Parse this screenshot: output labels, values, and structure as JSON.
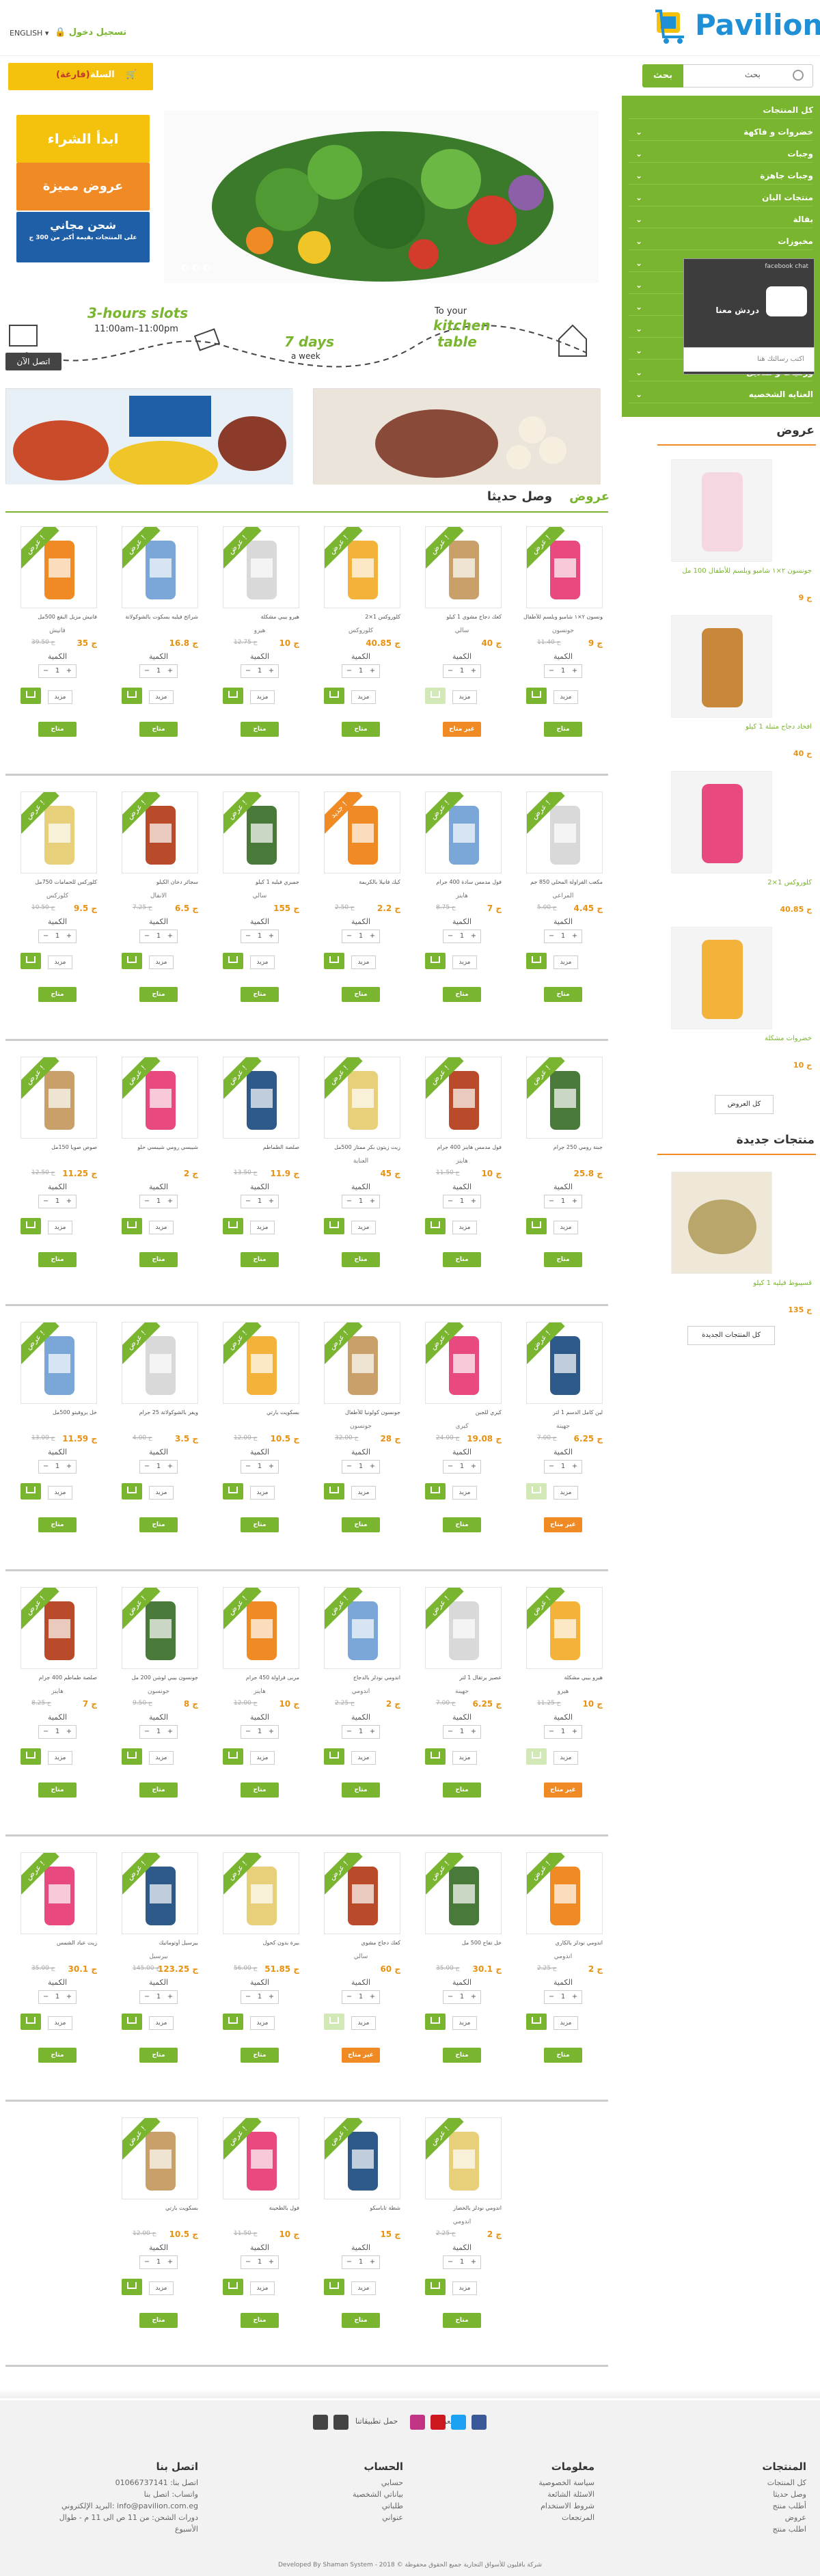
{
  "header": {
    "brand": "Pavilion",
    "language": "ENGLISH",
    "login": "تسجيل دخول",
    "cart_label": "السلة",
    "cart_status": "(فارغة)",
    "search_button": "بحث",
    "search_label": "بحث"
  },
  "sidebar": {
    "items": [
      "كل المنتجات",
      "خضروات و فاكهة",
      "وجبات",
      "وجبات جاهزة",
      "منتجات البان",
      "بقالة",
      "مخبوزات",
      "مجمدات",
      "لحوم",
      "منظفات",
      "مشروبات",
      "كنديرين",
      "ورقيات و مناديل",
      "العنايه الشخصيه"
    ]
  },
  "chat": {
    "title": "facebook chat",
    "cta": "دردش معنا",
    "input_placeholder": "اكتب رسالتك هنا"
  },
  "promos": {
    "start": "ابدأ الشراء",
    "offers": "عروض مميزة",
    "shipping_title": "شحن مجاني",
    "shipping_sub": "على المنتجات بقيمة أكبر من 300 ج"
  },
  "delivery": {
    "slots": "3-hours slots",
    "hours": "11:00am–11:00pm",
    "days": "7 days",
    "week": "a week",
    "to": "To your",
    "kitchen": "kitchen",
    "table": "table",
    "call": "اتصل الآن"
  },
  "section": {
    "tab_offers": "عروض",
    "tab_new": "وصل حديثا"
  },
  "card": {
    "qty_label": "الكمية",
    "qty_value": "1",
    "more": "مزيد",
    "available": "متاح",
    "unavailable": "غير متاح",
    "offer_ribbon": "عرض !",
    "new_ribbon": "جديد !"
  },
  "products": [
    [
      {
        "name": "جونسون ٢×١ شامبو وبلسم للأطفال",
        "brand": "جونسون",
        "price": "9 ج",
        "old": "11.40 ج",
        "status": "available"
      },
      {
        "name": "كعك دجاج مشوي 1 كيلو",
        "brand": "سالي",
        "price": "40 ج",
        "old": "",
        "status": "unavailable"
      },
      {
        "name": "كلوروكس 1×2",
        "brand": "كلوروكس",
        "price": "40.85 ج",
        "old": "",
        "status": "available"
      },
      {
        "name": "هيرو بيبي مشكلة",
        "brand": "هيرو",
        "price": "10 ج",
        "old": "12.75 ج",
        "status": "available"
      },
      {
        "name": "شرائح فيليه بسكوت بالشوكولاتة",
        "brand": "",
        "price": "16.8 ج",
        "old": "",
        "status": "available"
      },
      {
        "name": "فانيش مزيل البقع 500مل",
        "brand": "فانيش",
        "price": "35 ج",
        "old": "39.50 ج",
        "status": "available"
      }
    ],
    [
      {
        "name": "مكعب الفراولة المحلي 850 جم",
        "brand": "المراعي",
        "price": "4.45 ج",
        "old": "5.00 ج",
        "status": "available"
      },
      {
        "name": "فول مدمس سادة 400 جرام",
        "brand": "هاينز",
        "price": "7 ج",
        "old": "8.75 ج",
        "status": "available"
      },
      {
        "name": "كيك فانيلا بالكريمة",
        "brand": "",
        "price": "2.2 ج",
        "old": "2.50 ج",
        "status": "available"
      },
      {
        "name": "جمبري فيليه 1 كيلو",
        "brand": "سالي",
        "price": "155 ج",
        "old": "",
        "status": "available"
      },
      {
        "name": "سجائر دخان الكيلو",
        "brand": "الانفال",
        "price": "6.5 ج",
        "old": "7.25 ج",
        "status": "available"
      },
      {
        "name": "كلوركس للحمامات 750مل",
        "brand": "كلوركس",
        "price": "9.5 ج",
        "old": "10.50 ج",
        "status": "available"
      }
    ],
    [
      {
        "name": "جبنة رومي 250 جرام",
        "brand": "",
        "price": "25.8 ج",
        "old": "",
        "status": "available"
      },
      {
        "name": "فول مدمس هاينز 400 جرام",
        "brand": "هاينز",
        "price": "10 ج",
        "old": "11.50 ج",
        "status": "available"
      },
      {
        "name": "زيت زيتون بكر ممتاز 500مل",
        "brand": "العناية",
        "price": "45 ج",
        "old": "",
        "status": "available"
      },
      {
        "name": "صلصة الطماطم",
        "brand": "",
        "price": "11.9 ج",
        "old": "13.50 ج",
        "status": "available"
      },
      {
        "name": "شيبسي رومي شيبسي حلو",
        "brand": "",
        "price": "2 ج",
        "old": "",
        "status": "available"
      },
      {
        "name": "صوص صويا 150مل",
        "brand": "",
        "price": "11.25 ج",
        "old": "12.50 ج",
        "status": "available"
      }
    ],
    [
      {
        "name": "لبن كامل الدسم 1 لتر",
        "brand": "جهينة",
        "price": "6.25 ج",
        "old": "7.00 ج",
        "status": "unavailable"
      },
      {
        "name": "كيري للجبن",
        "brand": "كيري",
        "price": "19.08 ج",
        "old": "24.00 ج",
        "status": "available"
      },
      {
        "name": "جونسون كولونيا للأطفال",
        "brand": "جونسون",
        "price": "28 ج",
        "old": "32.00 ج",
        "status": "available"
      },
      {
        "name": "بسكويت بارتي",
        "brand": "",
        "price": "10.5 ج",
        "old": "12.00 ج",
        "status": "available"
      },
      {
        "name": "ويفر بالشوكولاتة 25 جرام",
        "brand": "",
        "price": "3.5 ج",
        "old": "4.00 ج",
        "status": "available"
      },
      {
        "name": "خل بروفيتو 500مل",
        "brand": "",
        "price": "11.59 ج",
        "old": "13.00 ج",
        "status": "available"
      }
    ],
    [
      {
        "name": "هيرو بيبي مشكلة",
        "brand": "هيرو",
        "price": "10 ج",
        "old": "11.25 ج",
        "status": "unavailable"
      },
      {
        "name": "عصير برتقال 1 لتر",
        "brand": "جهينة",
        "price": "6.25 ج",
        "old": "7.00 ج",
        "status": "available"
      },
      {
        "name": "اندومي نودلز بالدجاج",
        "brand": "اندومي",
        "price": "2 ج",
        "old": "2.25 ج",
        "status": "available"
      },
      {
        "name": "مربى فراولة 450 جرام",
        "brand": "هاينز",
        "price": "10 ج",
        "old": "12.00 ج",
        "status": "available"
      },
      {
        "name": "جونسون بيبي لوشن 200 مل",
        "brand": "جونسون",
        "price": "8 ج",
        "old": "9.50 ج",
        "status": "available"
      },
      {
        "name": "صلصة طماطم 400 جرام",
        "brand": "هاينز",
        "price": "7 ج",
        "old": "8.25 ج",
        "status": "available"
      }
    ],
    [
      {
        "name": "اندومي نودلز بالكاري",
        "brand": "اندومي",
        "price": "2 ج",
        "old": "2.25 ج",
        "status": "available"
      },
      {
        "name": "خل تفاح 500 مل",
        "brand": "",
        "price": "30.1 ج",
        "old": "35.00 ج",
        "status": "available"
      },
      {
        "name": "كعك دجاج مشوي",
        "brand": "سالي",
        "price": "60 ج",
        "old": "",
        "status": "unavailable"
      },
      {
        "name": "بيرة بدون كحول",
        "brand": "",
        "price": "51.85 ج",
        "old": "56.00 ج",
        "status": "available"
      },
      {
        "name": "بيرسيل أوتوماتيك",
        "brand": "بيرسيل",
        "price": "123.25 ج",
        "old": "145.00 ج",
        "status": "available"
      },
      {
        "name": "زيت عباد الشمس",
        "brand": "",
        "price": "30.1 ج",
        "old": "35.00 ج",
        "status": "available"
      }
    ],
    [
      {
        "name": "اندومي نودلز بالخضار",
        "brand": "اندومي",
        "price": "2 ج",
        "old": "2.25 ج",
        "status": "available"
      },
      {
        "name": "شطة تاباسكو",
        "brand": "",
        "price": "15 ج",
        "old": "",
        "status": "available"
      },
      {
        "name": "فول بالطحينة",
        "brand": "",
        "price": "10 ج",
        "old": "11.50 ج",
        "status": "available"
      },
      {
        "name": "بسكويت بارتي",
        "brand": "",
        "price": "10.5 ج",
        "old": "12.00 ج",
        "status": "available"
      }
    ]
  ],
  "rightcol": {
    "offers_title": "عروض",
    "items": [
      {
        "name": "جونسون ٢×١ شامبو وبلسم للأطفال 100 مل",
        "price": "9 ج"
      },
      {
        "name": "افخاد دجاج متبلة 1 كيلو",
        "price": "40 ج"
      },
      {
        "name": "كلوروكس 1×2",
        "price": "40.85 ج"
      },
      {
        "name": "خضروات مشكلة",
        "price": "10 ج"
      }
    ],
    "all_offers": "كل العروض",
    "new_title": "منتجات جديدة",
    "new_item_name": "قسيبوط فيليه 1 كيلو",
    "new_item_price": "135 ج",
    "all_new": "كل المنتجات الجديدة"
  },
  "footer": {
    "follow": "تابعونا",
    "app": "حمل تطبيقاتنا",
    "col1_title": "المنتجات",
    "col1_links": [
      "كل المنتجات",
      "وصل حديثا",
      "أطلب منتج",
      "عروض",
      "اطلب منتج"
    ],
    "col2_title": "معلومات",
    "col2_links": [
      "سياسة الخصوصية",
      "الاسئلة الشائعة",
      "شروط الاستخدام",
      "المرتجعات"
    ],
    "col3_title": "الحساب",
    "col3_links": [
      "حسابي",
      "بياناتي الشخصية",
      "طلباتي",
      "عنواني"
    ],
    "col4_title": "اتصل بنا",
    "col4_links": [
      "اتصل بنا: 01066737141",
      "واتساب: اتصل بنا",
      "البريد الإلكتروني: info@pavilion.com.eg",
      "دورات الشحن: من 11 ص الى 11 م - طوال الأسبوع"
    ],
    "copyright": "Developed By Shaman System - 2018 © شركة بافليون للأسواق التجارية جميع الحقوق محفوظة"
  }
}
